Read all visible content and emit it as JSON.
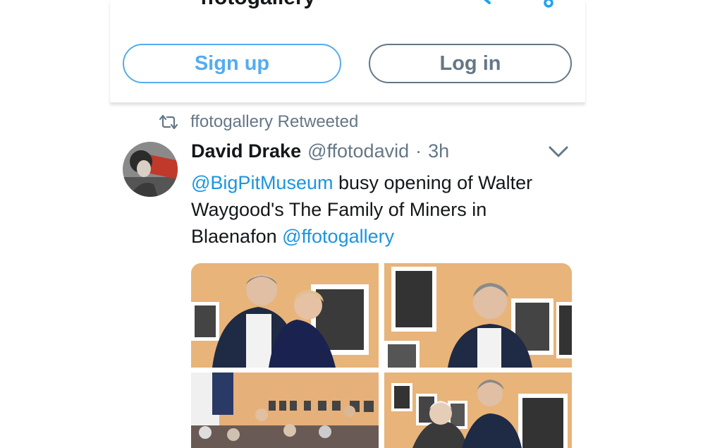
{
  "header": {
    "title": "ffotogallery",
    "signup_label": "Sign up",
    "login_label": "Log in",
    "icons": [
      "twitter-bird-icon",
      "search-icon",
      "person-icon"
    ],
    "accent": "#55acee"
  },
  "tweet": {
    "retweet_context": "ffotogallery Retweeted",
    "author_name": "David Drake",
    "author_handle": "@ffotodavid",
    "separator": "·",
    "time": "3h",
    "text": {
      "mention1": "@BigPitMuseum",
      "body": " busy opening of Walter Waygood's The Family of Miners in Blaenafon ",
      "mention2": "@ffotogallery"
    },
    "photo_count": 4
  }
}
